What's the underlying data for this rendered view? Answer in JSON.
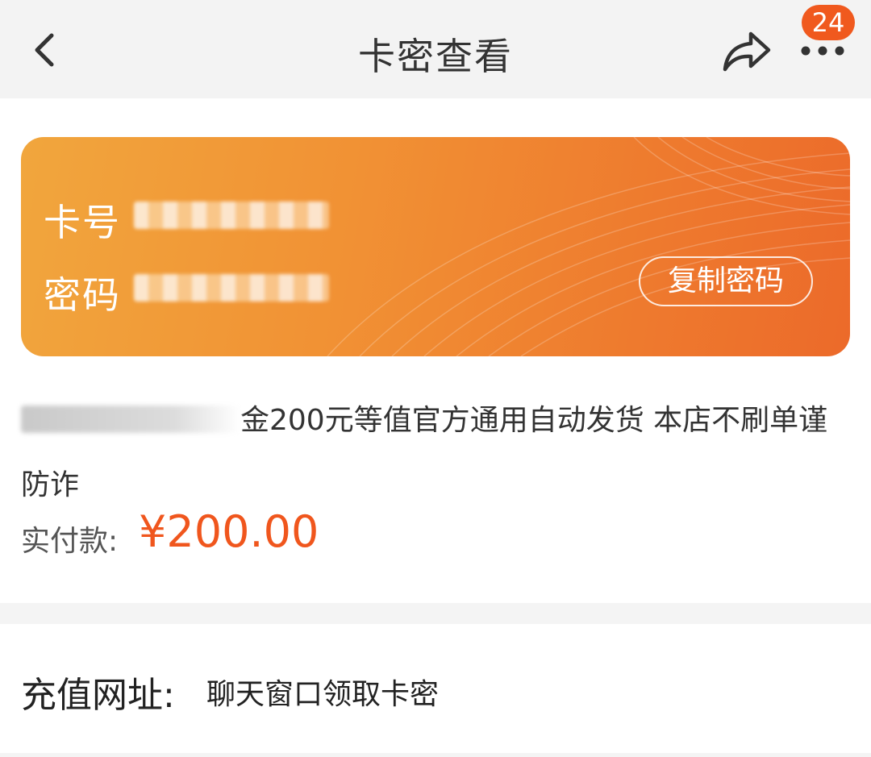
{
  "header": {
    "title": "卡密查看",
    "badge_count": "24",
    "icons": [
      "chevron-left-icon",
      "share-icon",
      "more-icon"
    ]
  },
  "card": {
    "card_number_label": "卡号",
    "password_label": "密码",
    "copy_button_label": "复制密码",
    "gradient_colors": [
      "#f1a63d",
      "#ec6a2a"
    ]
  },
  "product": {
    "description_text": "金200元等值官方通用自动发货 本店不刷单谨防诈"
  },
  "payment": {
    "label": "实付款:",
    "amount": "¥200.00",
    "amount_color": "#f0561d"
  },
  "recharge": {
    "label": "充值网址:",
    "value": "聊天窗口领取卡密"
  }
}
